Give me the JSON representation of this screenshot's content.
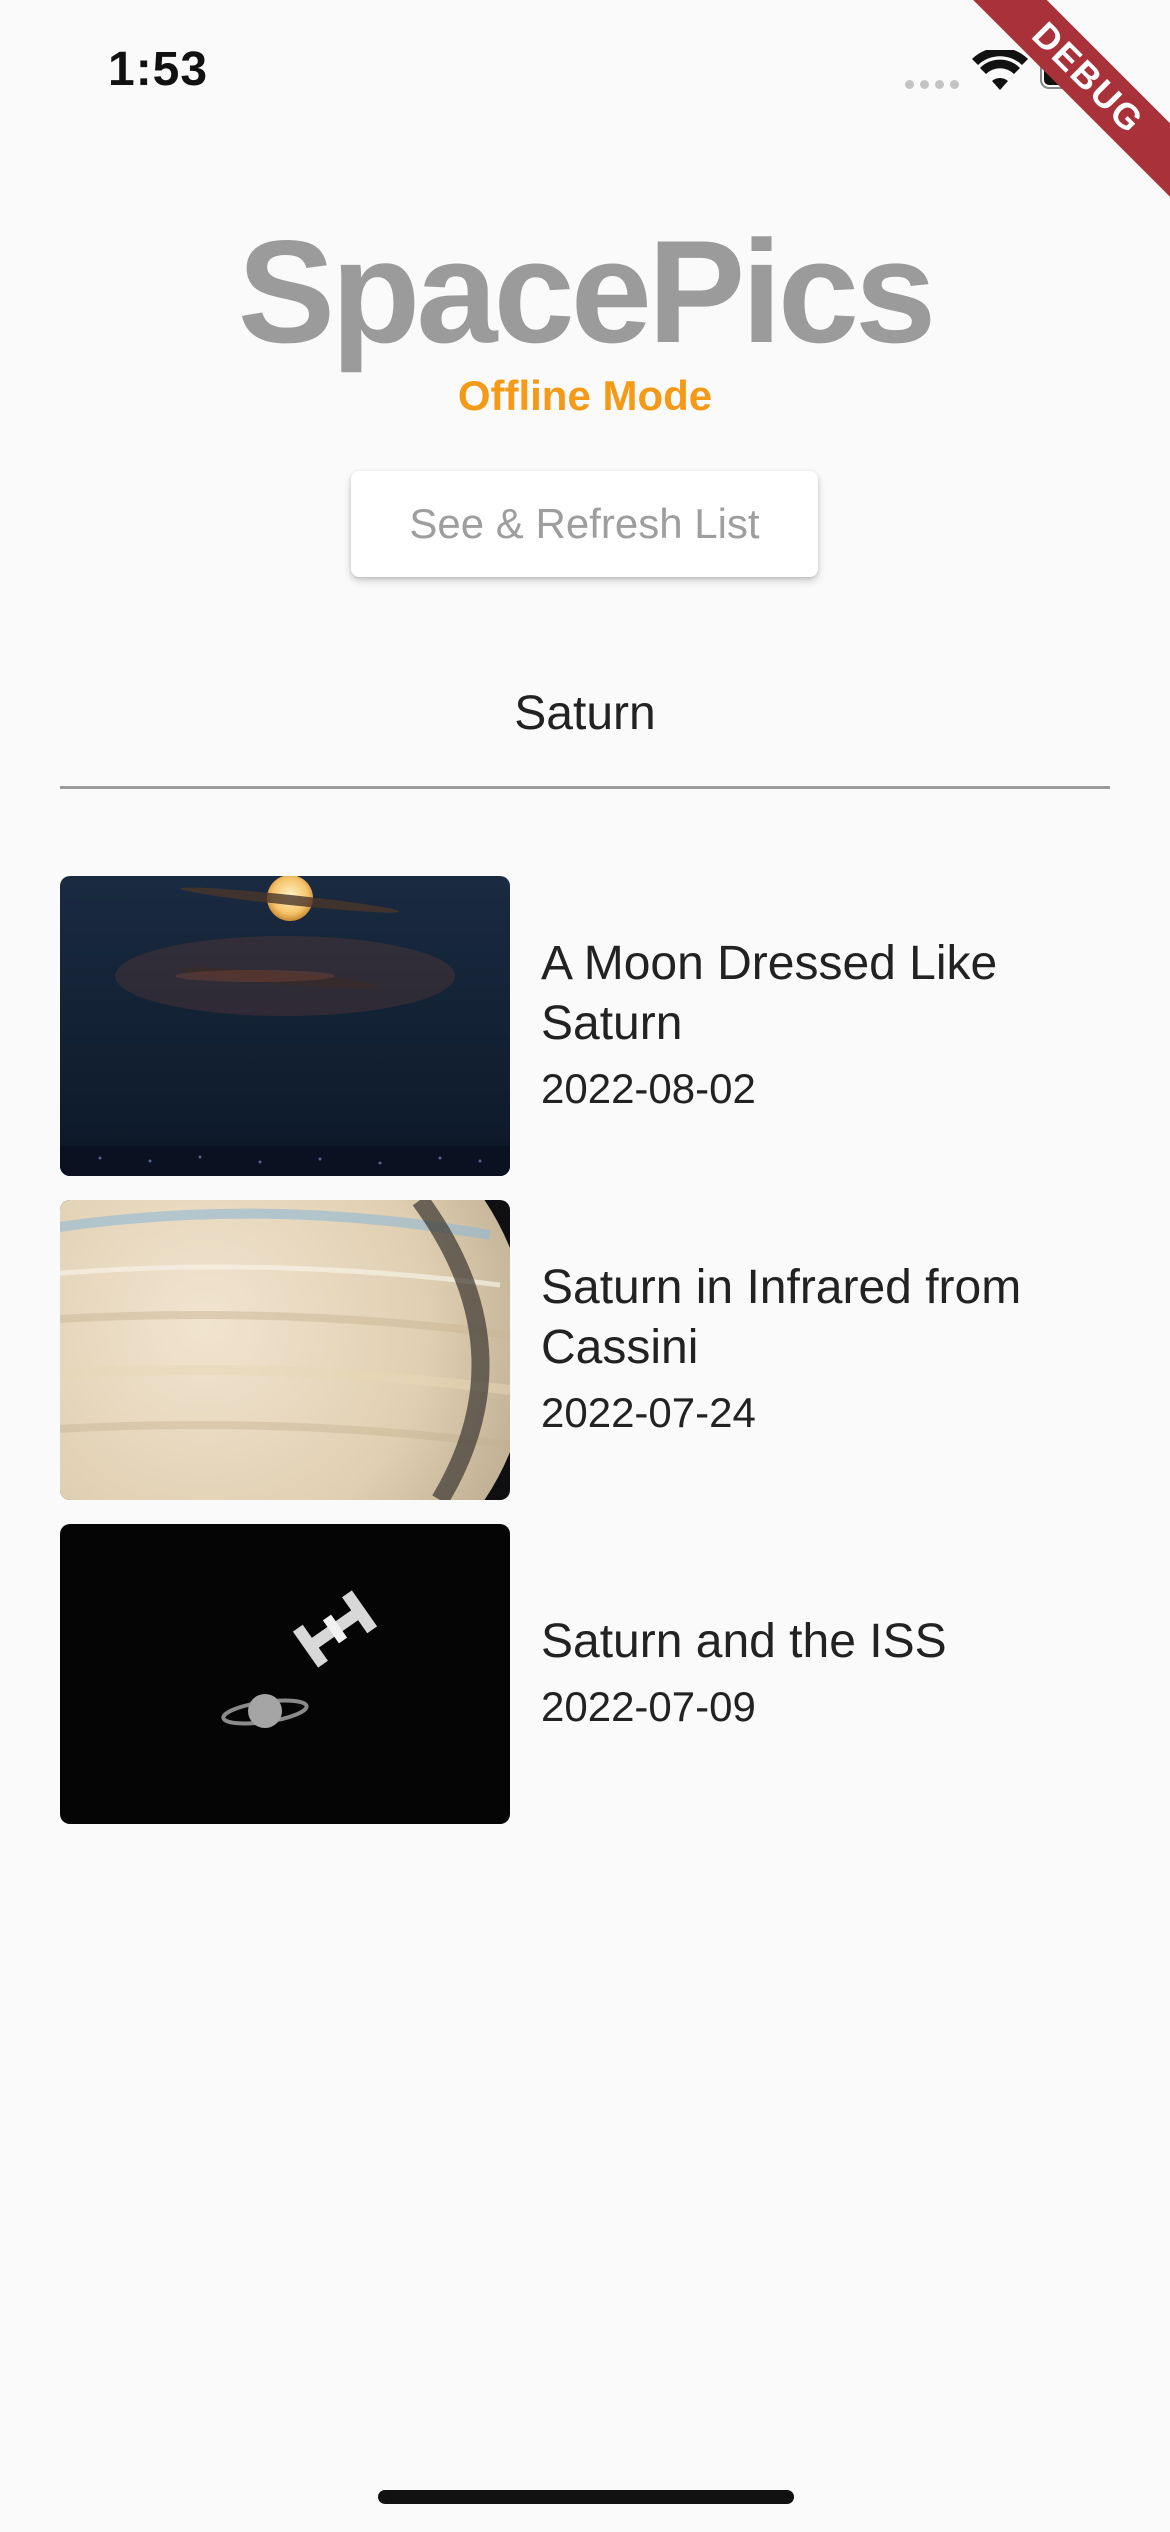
{
  "status_bar": {
    "time": "1:53"
  },
  "debug_banner": {
    "label": "DEBUG"
  },
  "header": {
    "title": "SpacePics",
    "mode": "Offline Mode",
    "refresh_button_label": "See & Refresh List"
  },
  "search": {
    "value": "Saturn"
  },
  "results": [
    {
      "title": "A Moon Dressed Like Saturn",
      "date": "2022-08-02",
      "image": "moon-saturn-thumbnail"
    },
    {
      "title": "Saturn in Infrared from Cassini",
      "date": "2022-07-24",
      "image": "saturn-infrared-thumbnail"
    },
    {
      "title": "Saturn and the ISS",
      "date": "2022-07-09",
      "image": "saturn-iss-thumbnail"
    }
  ],
  "colors": {
    "background": "#fafafa",
    "title": "#9b9b9b",
    "offline_accent": "#f59a17",
    "button_text": "#9e9e9e",
    "debug_ribbon": "#a8313a"
  },
  "icons": [
    "wifi-icon",
    "battery-icon",
    "signal-icon"
  ]
}
